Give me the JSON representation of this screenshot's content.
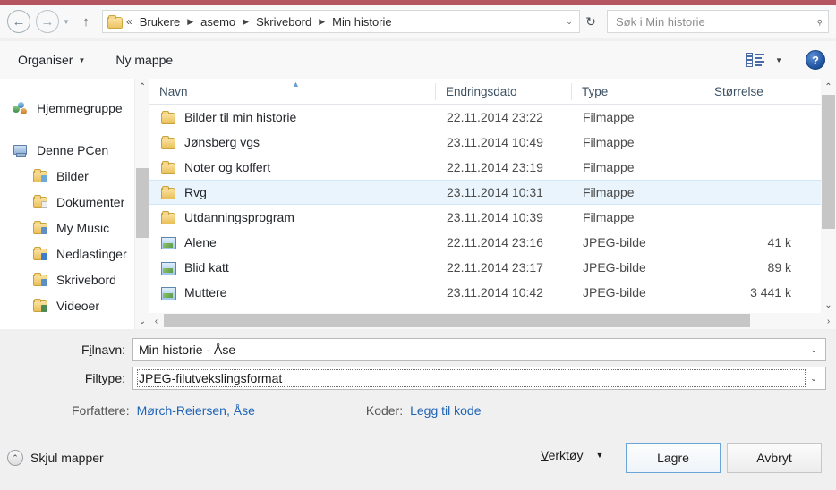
{
  "navigation": {
    "back_icon": "arrow-left-icon",
    "forward_icon": "arrow-right-icon",
    "history_caret": "▼",
    "up_icon": "↑",
    "breadcrumb_lead": "«",
    "crumbs": [
      "Brukere",
      "asemo",
      "Skrivebord",
      "Min historie"
    ],
    "crumb_separator": "▶",
    "address_dropdown": "⌄",
    "refresh_icon": "↻",
    "search_placeholder": "Søk i Min historie",
    "search_value": "",
    "search_icon": "⌕"
  },
  "toolbar": {
    "organize_label": "Organiser",
    "organize_caret": "▼",
    "new_folder_label": "Ny mappe",
    "view_caret": "▼",
    "help_label": "?"
  },
  "sidebar": {
    "items": [
      {
        "label": "Hjemmegruppe",
        "icon": "homegroup-icon",
        "level": 0
      },
      {
        "label": "Denne PCen",
        "icon": "computer-icon",
        "level": 0
      },
      {
        "label": "Bilder",
        "icon": "pictures-folder-icon",
        "level": 1,
        "tint": "#6ea9dc"
      },
      {
        "label": "Dokumenter",
        "icon": "documents-folder-icon",
        "level": 1,
        "tint": "#e7e7e7"
      },
      {
        "label": "My Music",
        "icon": "music-folder-icon",
        "level": 1,
        "tint": "#5f8fc6"
      },
      {
        "label": "Nedlastinger",
        "icon": "downloads-folder-icon",
        "level": 1,
        "tint": "#3f7dc4"
      },
      {
        "label": "Skrivebord",
        "icon": "desktop-folder-icon",
        "level": 1,
        "tint": "#5b8ec2"
      },
      {
        "label": "Videoer",
        "icon": "videos-folder-icon",
        "level": 1,
        "tint": "#4f8a56"
      }
    ],
    "scroll_up": "⌃",
    "scroll_down": "⌄"
  },
  "filelist": {
    "columns": [
      "Navn",
      "Endringsdato",
      "Type",
      "Størrelse"
    ],
    "sort_column": "Navn",
    "sort_arrow": "▲",
    "rows": [
      {
        "name": "Bilder til min historie",
        "date": "22.11.2014 23:22",
        "type": "Filmappe",
        "size": "",
        "icon": "folder-icon",
        "selected": false
      },
      {
        "name": "Jønsberg vgs",
        "date": "23.11.2014 10:49",
        "type": "Filmappe",
        "size": "",
        "icon": "folder-icon",
        "selected": false
      },
      {
        "name": "Noter og koffert",
        "date": "22.11.2014 23:19",
        "type": "Filmappe",
        "size": "",
        "icon": "folder-icon",
        "selected": false
      },
      {
        "name": "Rvg",
        "date": "23.11.2014 10:31",
        "type": "Filmappe",
        "size": "",
        "icon": "folder-icon",
        "selected": true
      },
      {
        "name": "Utdanningsprogram",
        "date": "23.11.2014 10:39",
        "type": "Filmappe",
        "size": "",
        "icon": "folder-icon",
        "selected": false
      },
      {
        "name": "Alene",
        "date": "22.11.2014 23:16",
        "type": "JPEG-bilde",
        "size": "41 k",
        "icon": "jpeg-image-icon",
        "selected": false
      },
      {
        "name": "Blid katt",
        "date": "22.11.2014 23:17",
        "type": "JPEG-bilde",
        "size": "89 k",
        "icon": "jpeg-image-icon",
        "selected": false
      },
      {
        "name": "Muttere",
        "date": "23.11.2014 10:42",
        "type": "JPEG-bilde",
        "size": "3 441 k",
        "icon": "jpeg-image-icon",
        "selected": false
      }
    ],
    "scroll_up": "⌃",
    "scroll_down": "⌄",
    "scroll_left": "‹",
    "scroll_right": "›"
  },
  "form": {
    "filename_label_pre": "F",
    "filename_label_accel": "i",
    "filename_label_post": "lnavn:",
    "filename_value": "Min historie - Åse",
    "filetype_label_pre": "Filt",
    "filetype_label_accel": "y",
    "filetype_label_post": "pe:",
    "filetype_value": "JPEG-filutvekslingsformat",
    "dropdown_caret": "⌄",
    "authors_label": "Forfattere:",
    "authors_value": "Mørch-Reiersen, Åse",
    "tags_label": "Koder:",
    "tags_value": "Legg til kode"
  },
  "footer": {
    "hide_folders_label": "Skjul mapper",
    "hide_folders_icon": "⌃",
    "tools_label_pre": "V",
    "tools_label_post": "erktøy",
    "tools_caret": "▼",
    "save_label": "Lagre",
    "cancel_label": "Avbryt"
  },
  "colors": {
    "title_strip": "#b5555f",
    "selection": "#e9f4fc",
    "link": "#1f63b7",
    "accent_button_border": "#6aa4d8"
  }
}
